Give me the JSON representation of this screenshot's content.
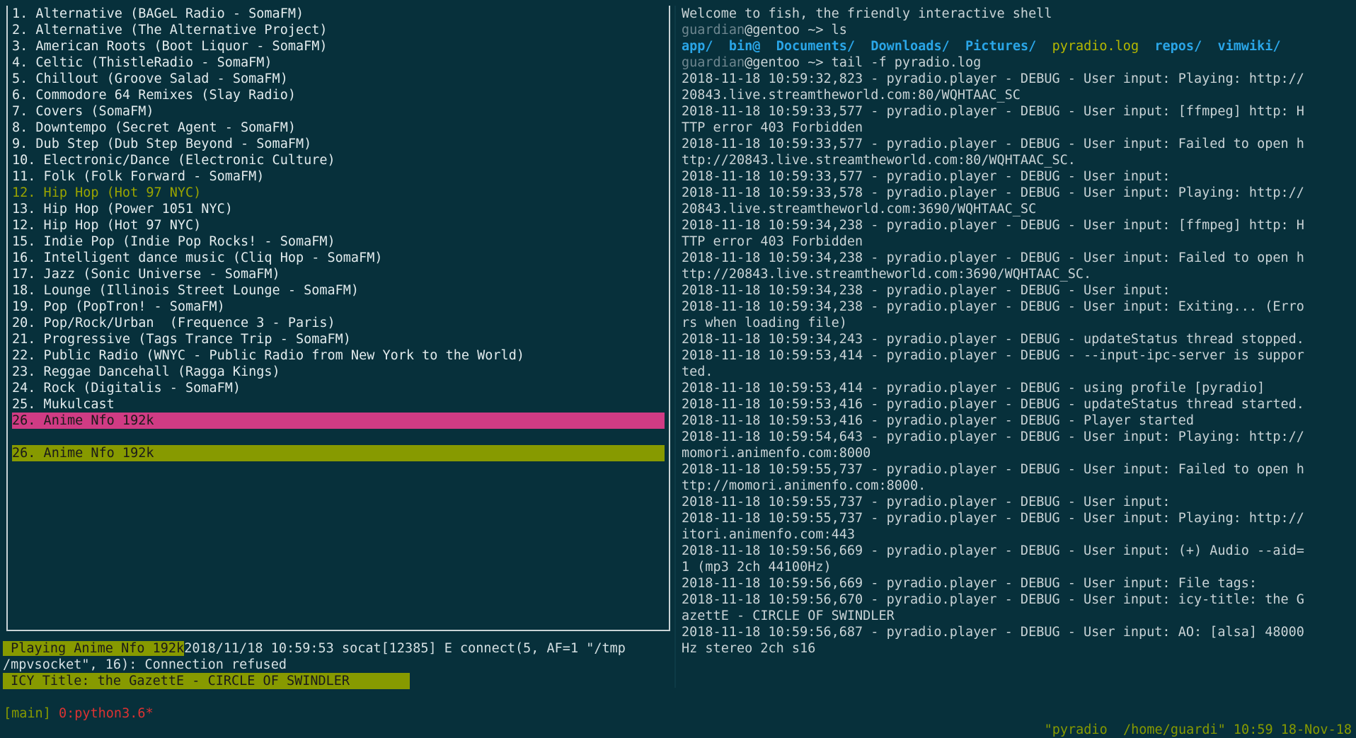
{
  "stations": [
    {
      "text": "1. Alternative (BAGeL Radio - SomaFM)"
    },
    {
      "text": "2. Alternative (The Alternative Project)"
    },
    {
      "text": "3. American Roots (Boot Liquor - SomaFM)"
    },
    {
      "text": "4. Celtic (ThistleRadio - SomaFM)"
    },
    {
      "text": "5. Chillout (Groove Salad - SomaFM)"
    },
    {
      "text": "6. Commodore 64 Remixes (Slay Radio)"
    },
    {
      "text": "7. Covers (SomaFM)"
    },
    {
      "text": "8. Downtempo (Secret Agent - SomaFM)"
    },
    {
      "text": "9. Dub Step (Dub Step Beyond - SomaFM)"
    },
    {
      "text": "10. Electronic/Dance (Electronic Culture)"
    },
    {
      "text": "11. Folk (Folk Forward - SomaFM)"
    },
    {
      "text": "12. Hip Hop (Hot 97 NYC)"
    },
    {
      "text": "13. Hip Hop (Power 1051 NYC)"
    },
    {
      "text": "12. Hip Hop (Hot 97 NYC)"
    },
    {
      "text": "15. Indie Pop (Indie Pop Rocks! - SomaFM)"
    },
    {
      "text": "16. Intelligent dance music (Cliq Hop - SomaFM)"
    },
    {
      "text": "17. Jazz (Sonic Universe - SomaFM)"
    },
    {
      "text": "18. Lounge (Illinois Street Lounge - SomaFM)"
    },
    {
      "text": "19. Pop (PopTron! - SomaFM)"
    },
    {
      "text": "20. Pop/Rock/Urban  (Frequence 3 - Paris)"
    },
    {
      "text": "21. Progressive (Tags Trance Trip - SomaFM)"
    },
    {
      "text": "22. Public Radio (WNYC - Public Radio from New York to the World)"
    },
    {
      "text": "23. Reggae Dancehall (Ragga Kings)"
    },
    {
      "text": "24. Rock (Digitalis - SomaFM)"
    },
    {
      "text": "25. Mukulcast"
    }
  ],
  "selected_station": "26. Anime Nfo 192k",
  "playing_station": "26. Anime Nfo 192k",
  "status": {
    "playing_label": " Playing Anime Nfo 192k",
    "socat_msg_1": "2018/11/18 10:59:53 socat[12385] E connect(5, AF=1 \"/tmp",
    "socat_msg_2": "/mpvsocket\", 16): Connection refused",
    "icy_title": " ICY Title: the GazettE - CIRCLE OF SWINDLER"
  },
  "terminal": {
    "welcome": "Welcome to fish, the friendly interactive shell",
    "prompt_user": "guardian",
    "prompt_host": "@gentoo ~> ",
    "cmd1": "ls",
    "ls_entries": [
      {
        "name": "app/",
        "kind": "dir"
      },
      {
        "name": "bin@",
        "kind": "dir"
      },
      {
        "name": "Documents/",
        "kind": "dir"
      },
      {
        "name": "Downloads/",
        "kind": "dir"
      },
      {
        "name": "Pictures/",
        "kind": "dir"
      },
      {
        "name": "pyradio.log",
        "kind": "file"
      },
      {
        "name": "repos/",
        "kind": "dir"
      },
      {
        "name": "vimwiki/",
        "kind": "dir"
      }
    ],
    "cmd2": "tail -f pyradio.log",
    "log_lines": [
      "2018-11-18 10:59:32,823 - pyradio.player - DEBUG - User input: Playing: http://",
      "20843.live.streamtheworld.com:80/WQHTAAC_SC",
      "2018-11-18 10:59:33,577 - pyradio.player - DEBUG - User input: [ffmpeg] http: H",
      "TTP error 403 Forbidden",
      "2018-11-18 10:59:33,577 - pyradio.player - DEBUG - User input: Failed to open h",
      "ttp://20843.live.streamtheworld.com:80/WQHTAAC_SC.",
      "2018-11-18 10:59:33,577 - pyradio.player - DEBUG - User input:",
      "2018-11-18 10:59:33,578 - pyradio.player - DEBUG - User input: Playing: http://",
      "20843.live.streamtheworld.com:3690/WQHTAAC_SC",
      "2018-11-18 10:59:34,238 - pyradio.player - DEBUG - User input: [ffmpeg] http: H",
      "TTP error 403 Forbidden",
      "2018-11-18 10:59:34,238 - pyradio.player - DEBUG - User input: Failed to open h",
      "ttp://20843.live.streamtheworld.com:3690/WQHTAAC_SC.",
      "2018-11-18 10:59:34,238 - pyradio.player - DEBUG - User input:",
      "2018-11-18 10:59:34,238 - pyradio.player - DEBUG - User input: Exiting... (Erro",
      "rs when loading file)",
      "2018-11-18 10:59:34,243 - pyradio.player - DEBUG - updateStatus thread stopped.",
      "2018-11-18 10:59:53,414 - pyradio.player - DEBUG - --input-ipc-server is suppor",
      "ted.",
      "2018-11-18 10:59:53,414 - pyradio.player - DEBUG - using profile [pyradio]",
      "2018-11-18 10:59:53,416 - pyradio.player - DEBUG - updateStatus thread started.",
      "2018-11-18 10:59:53,416 - pyradio.player - DEBUG - Player started",
      "2018-11-18 10:59:54,643 - pyradio.player - DEBUG - User input: Playing: http://",
      "momori.animenfo.com:8000",
      "2018-11-18 10:59:55,737 - pyradio.player - DEBUG - User input: Failed to open h",
      "ttp://momori.animenfo.com:8000.",
      "2018-11-18 10:59:55,737 - pyradio.player - DEBUG - User input:",
      "2018-11-18 10:59:55,737 - pyradio.player - DEBUG - User input: Playing: http://",
      "itori.animenfo.com:443",
      "2018-11-18 10:59:56,669 - pyradio.player - DEBUG - User input: (+) Audio --aid=",
      "1 (mp3 2ch 44100Hz)",
      "2018-11-18 10:59:56,669 - pyradio.player - DEBUG - User input: File tags:",
      "2018-11-18 10:59:56,670 - pyradio.player - DEBUG - User input: icy-title: the G",
      "azettE - CIRCLE OF SWINDLER",
      "2018-11-18 10:59:56,687 - pyradio.player - DEBUG - User input: AO: [alsa] 48000",
      "Hz stereo 2ch s16"
    ]
  },
  "tmux": {
    "session": "[main]",
    "window": " 0:python3.6*",
    "right": "\"pyradio  /home/guardi\" 10:59 18-Nov-18"
  },
  "colors": {
    "background": "#07303b",
    "selected_bar": "#d03b84",
    "playing_bar": "#879a00",
    "dir": "#2aa6e8",
    "file": "#b5b800"
  }
}
